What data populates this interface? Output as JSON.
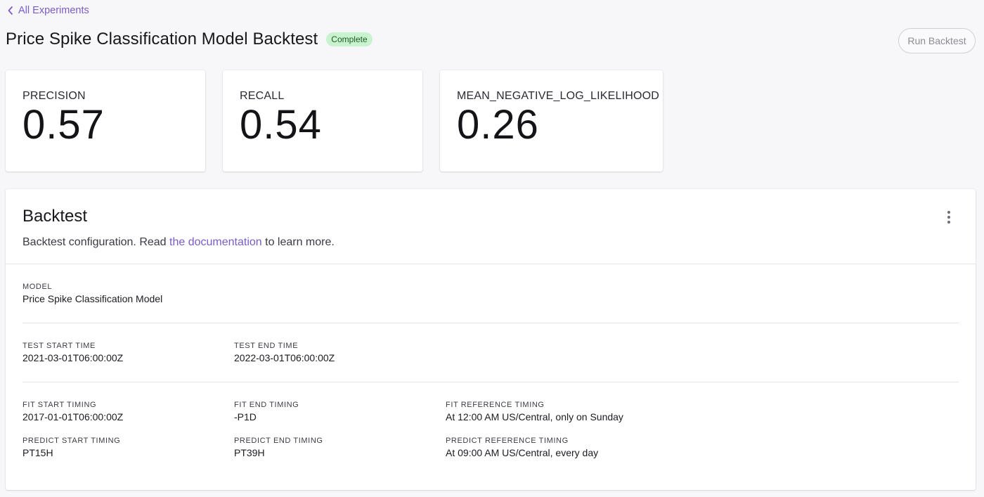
{
  "nav": {
    "back_label": "All Experiments"
  },
  "header": {
    "title": "Price Spike Classification Model Backtest",
    "status": "Complete",
    "run_button": "Run Backtest"
  },
  "metrics": [
    {
      "label": "PRECISION",
      "value": "0.57"
    },
    {
      "label": "RECALL",
      "value": "0.54"
    },
    {
      "label": "MEAN_NEGATIVE_LOG_LIKELIHOOD",
      "value": "0.26"
    }
  ],
  "panel": {
    "title": "Backtest",
    "desc_prefix": "Backtest configuration. Read ",
    "desc_link": "the documentation",
    "desc_suffix": " to learn more."
  },
  "config": {
    "model": {
      "label": "MODEL",
      "value": "Price Spike Classification Model"
    },
    "test_start": {
      "label": "TEST START TIME",
      "value": "2021-03-01T06:00:00Z"
    },
    "test_end": {
      "label": "TEST END TIME",
      "value": "2022-03-01T06:00:00Z"
    },
    "fit_start": {
      "label": "FIT START TIMING",
      "value": "2017-01-01T06:00:00Z"
    },
    "fit_end": {
      "label": "FIT END TIMING",
      "value": "-P1D"
    },
    "fit_ref": {
      "label": "FIT REFERENCE TIMING",
      "value": "At 12:00 AM US/Central, only on Sunday"
    },
    "predict_start": {
      "label": "PREDICT START TIMING",
      "value": "PT15H"
    },
    "predict_end": {
      "label": "PREDICT END TIMING",
      "value": "PT39H"
    },
    "predict_ref": {
      "label": "PREDICT REFERENCE TIMING",
      "value": "At 09:00 AM US/Central, every day"
    }
  },
  "colors": {
    "accent": "#7a5cc8",
    "badge_bg": "#c9f2cf",
    "badge_text": "#1d5b27"
  },
  "icons": {
    "back": "chevron-left-icon",
    "menu": "more-vertical-icon"
  }
}
